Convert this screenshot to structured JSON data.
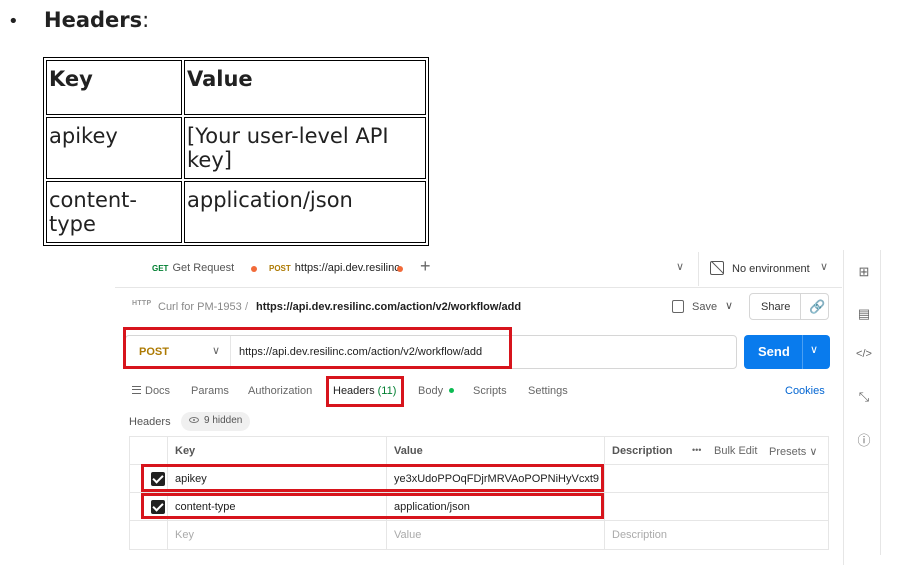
{
  "doc": {
    "bullet": "•",
    "heading": "Headers",
    "heading_suffix": ":",
    "table": {
      "header": [
        "Key",
        "Value"
      ],
      "rows": [
        [
          "apikey",
          "[Your user-level API key]"
        ],
        [
          "content-type",
          "application/json"
        ]
      ]
    }
  },
  "tabs": [
    {
      "method": "GET",
      "label": "Get Request"
    },
    {
      "method": "POST",
      "label": "https://api.dev.resilinc."
    }
  ],
  "tab_add": "+",
  "tab_menu": "∨",
  "environment": {
    "label": "No environment",
    "icon": "no-environment-icon",
    "chevron": "∨"
  },
  "breadcrumb": {
    "icon": "HTTP",
    "parent": "Curl for PM-1953",
    "separator": "/",
    "current": "https://api.dev.resilinc.com/action/v2/workflow/add"
  },
  "save": {
    "label": "Save",
    "chevron": "∨"
  },
  "share": {
    "label": "Share",
    "icon": "🔗"
  },
  "request": {
    "method": "POST",
    "method_chevron": "∨",
    "url": "https://api.dev.resilinc.com/action/v2/workflow/add",
    "send_label": "Send",
    "send_chevron": "∨"
  },
  "request_tabs": {
    "docs": "Docs",
    "params": "Params",
    "authorization": "Authorization",
    "headers": "Headers",
    "headers_count": "(11)",
    "body": "Body",
    "scripts": "Scripts",
    "settings": "Settings",
    "cookies": "Cookies"
  },
  "headers_panel": {
    "label": "Headers",
    "hidden": "9 hidden",
    "columns": {
      "key": "Key",
      "value": "Value",
      "description": "Description"
    },
    "more": "•••",
    "bulk_edit": "Bulk Edit",
    "presets": "Presets ∨",
    "rows": [
      {
        "key": "apikey",
        "value": "ye3xUdoPPOqFDjrMRVAoPOPNiHyVcxt9",
        "checked": true
      },
      {
        "key": "content-type",
        "value": "application/json",
        "checked": true
      }
    ],
    "placeholder": {
      "key": "Key",
      "value": "Value",
      "description": "Description"
    }
  },
  "colors": {
    "highlight": "#d7141c",
    "send": "#097bed",
    "post": "#ad7a03",
    "get": "#007f31",
    "accent": "#f26b3a"
  },
  "rail_icons": {
    "icon1": "⊞",
    "icon2": "▤",
    "icon3": "</>",
    "icon4": "⤡",
    "icon5": "ⓘ"
  }
}
